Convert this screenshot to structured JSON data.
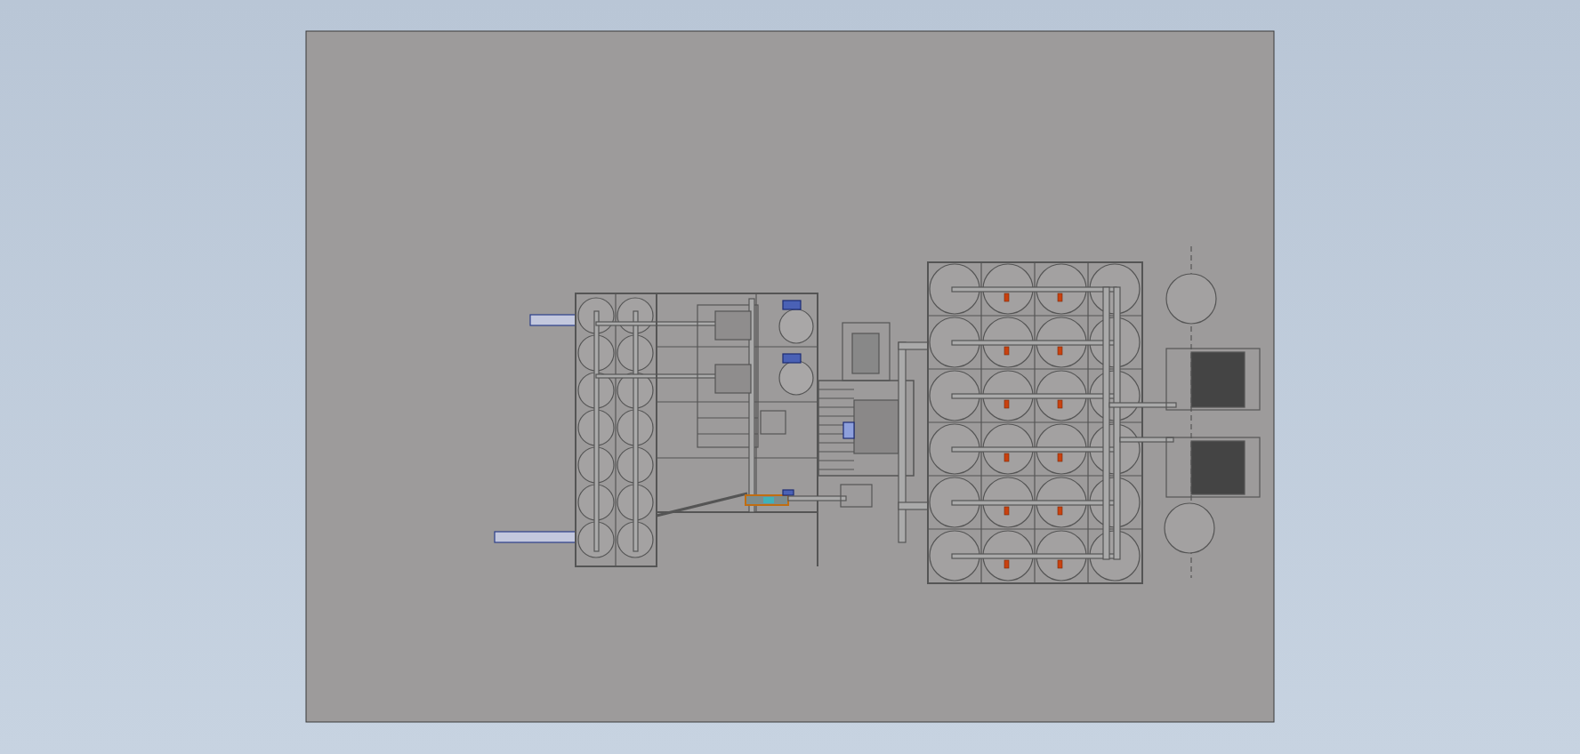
{
  "drawing_sheet": {
    "views": [
      {
        "kind": "plan"
      }
    ]
  }
}
